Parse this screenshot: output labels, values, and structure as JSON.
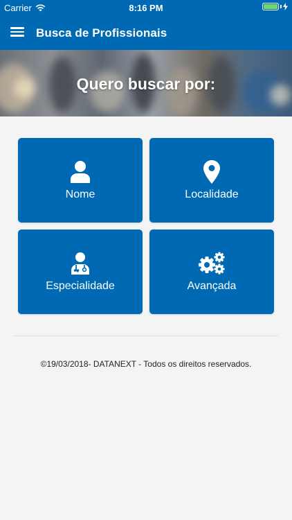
{
  "status_bar": {
    "carrier": "Carrier",
    "time": "8:16 PM",
    "battery_level": 1.0,
    "battery_color": "#6fd96b"
  },
  "nav": {
    "title": "Busca de Profissionais",
    "menu_icon": "hamburger-menu-icon"
  },
  "hero": {
    "title": "Quero buscar por:"
  },
  "tiles": [
    {
      "label": "Nome",
      "icon": "person-icon"
    },
    {
      "label": "Localidade",
      "icon": "map-pin-icon"
    },
    {
      "label": "Especialidade",
      "icon": "doctor-icon"
    },
    {
      "label": "Avançada",
      "icon": "gears-icon"
    }
  ],
  "footer": {
    "text": "©19/03/2018- DATANEXT - Todos os direitos reservados."
  },
  "colors": {
    "primary": "#0069b4",
    "background": "#f4f4f4"
  }
}
